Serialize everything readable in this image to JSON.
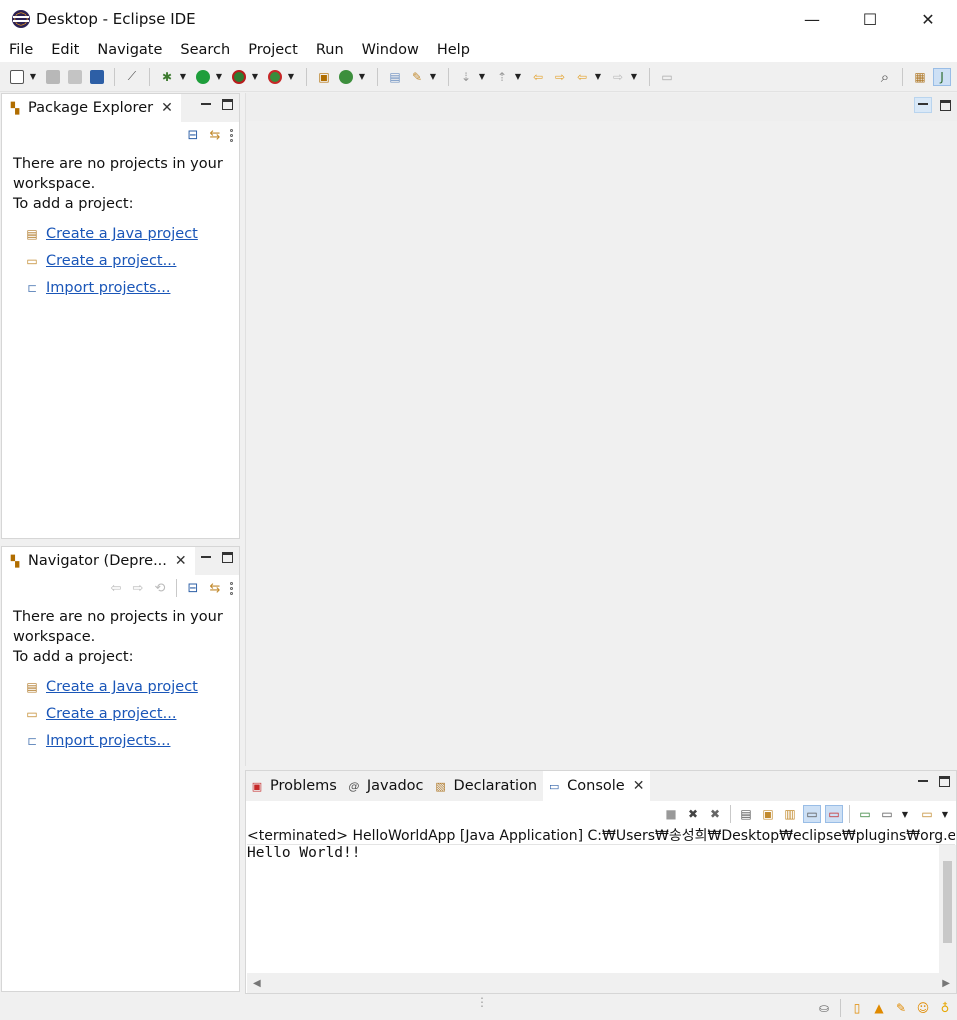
{
  "window": {
    "title": "Desktop - Eclipse IDE",
    "minimize": "—",
    "maximize": "☐",
    "close": "✕"
  },
  "menu": [
    "File",
    "Edit",
    "Navigate",
    "Search",
    "Project",
    "Run",
    "Window",
    "Help"
  ],
  "package_explorer": {
    "tab_label": "Package Explorer",
    "empty_line1": "There are no projects in your workspace.",
    "empty_line2": "To add a project:",
    "links": [
      "Create a Java project",
      "Create a project...",
      "Import projects..."
    ]
  },
  "navigator": {
    "tab_label": "Navigator (Depre...",
    "empty_line1": "There are no projects in your workspace.",
    "empty_line2": "To add a project:",
    "links": [
      "Create a Java project",
      "Create a project...",
      "Import projects..."
    ]
  },
  "bottom_tabs": {
    "problems": "Problems",
    "javadoc": "Javadoc",
    "declaration": "Declaration",
    "console": "Console"
  },
  "console": {
    "launch_line": "<terminated> HelloWorldApp [Java Application] C:₩Users₩송성희₩Desktop₩eclipse₩plugins₩org.eclipse",
    "output": "Hello World!!"
  },
  "colors": {
    "link": "#1a56b8",
    "panel_bg": "#ffffff",
    "chrome_bg": "#f0f0f0",
    "run_green": "#1e9e3b",
    "status_orange": "#e08a00"
  }
}
